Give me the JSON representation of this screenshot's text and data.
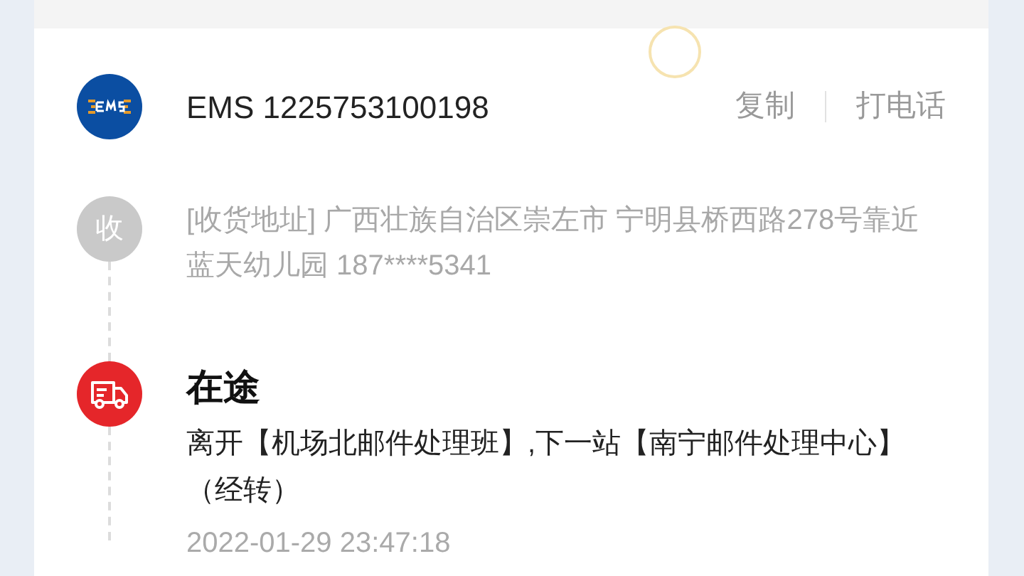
{
  "shipment": {
    "tracking_number": "EMS 1225753100198",
    "actions": [
      "复制",
      "打电话"
    ]
  },
  "address": {
    "badge": "收",
    "text": "[收货地址] 广西壮族自治区崇左市 宁明县桥西路278号靠近蓝天幼儿园 187****5341"
  },
  "events": [
    {
      "status": "在途",
      "description": "离开【机场北邮件处理班】,下一站【南宁邮件处理中心】（经转）",
      "time": "2022-01-29 23:47:18"
    }
  ]
}
